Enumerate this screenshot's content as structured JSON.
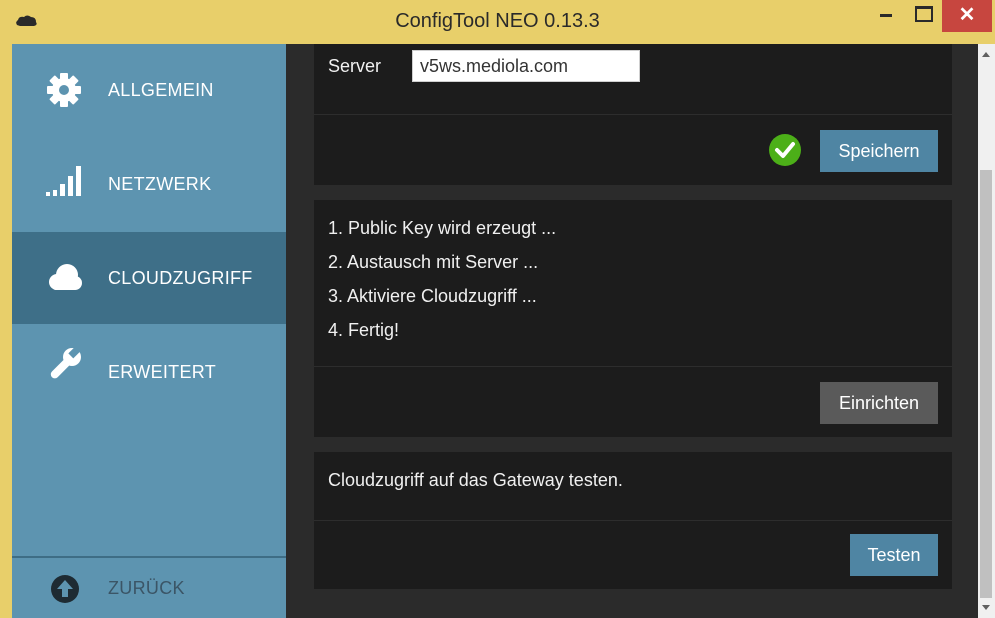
{
  "window": {
    "title": "ConfigTool NEO 0.13.3",
    "close_glyph": "✕",
    "app_icon": "cloud-logo-icon"
  },
  "sidebar": {
    "items": [
      {
        "label": "ALLGEMEIN",
        "icon": "gear-icon"
      },
      {
        "label": "NETZWERK",
        "icon": "signal-bars-icon"
      },
      {
        "label": "CLOUDZUGRIFF",
        "icon": "cloud-icon",
        "active": true
      },
      {
        "label": "ERWEITERT",
        "icon": "wrench-icon"
      }
    ],
    "back": {
      "label": "ZURÜCK",
      "icon": "arrow-up-circle-icon"
    }
  },
  "server_panel": {
    "label": "Server",
    "value": "v5ws.mediola.com",
    "status_icon": "check-circle-icon",
    "save_label": "Speichern"
  },
  "setup_panel": {
    "steps": [
      "1. Public Key wird erzeugt ...",
      "2. Austausch mit Server ...",
      "3. Aktiviere Cloudzugriff ...",
      "4. Fertig!"
    ],
    "button_label": "Einrichten"
  },
  "test_panel": {
    "text": "Cloudzugriff auf das Gateway testen.",
    "button_label": "Testen"
  },
  "colors": {
    "titlebar": "#e8cf6a",
    "sidebar": "#5d94b0",
    "sidebar_active": "#3e6f88",
    "content_bg": "#2b2b2b",
    "panel_bg": "#1c1c1c",
    "button_blue": "#4f85a3",
    "button_gray": "#5a5a5a",
    "success": "#4caf18",
    "close_button": "#c7463f"
  }
}
